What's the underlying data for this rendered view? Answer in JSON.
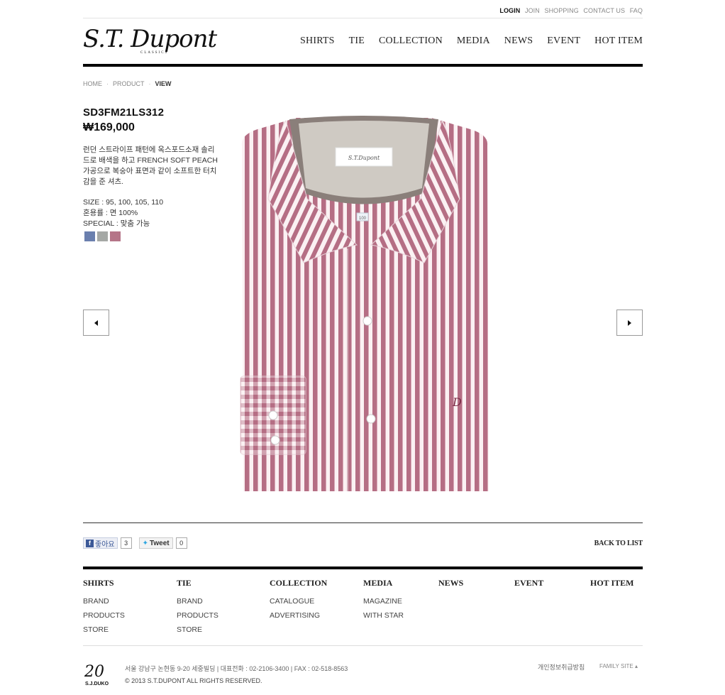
{
  "util": {
    "login": "LOGIN",
    "join": "JOIN",
    "shopping": "SHOPPING",
    "contact": "CONTACT US",
    "faq": "FAQ"
  },
  "logo": {
    "main": "S.T. Dupont",
    "sub": "CLASSICS"
  },
  "gnb": [
    "SHIRTS",
    "TIE",
    "COLLECTION",
    "MEDIA",
    "NEWS",
    "EVENT",
    "HOT ITEM"
  ],
  "breadcrumb": {
    "home": "HOME",
    "product": "PRODUCT",
    "current": "VIEW",
    "sep": "·"
  },
  "product": {
    "code": "SD3FM21LS312",
    "price": "₩169,000",
    "desc": "런던 스트라이프 패턴에 옥스포드소재 솔리드로 배색을 하고 FRENCH SOFT PEACH 가공으로 복숭아 표면과 같이 소프트한 터치감을 준 셔츠.",
    "size": "SIZE : 95, 100, 105, 110",
    "material": "혼용률 : 면 100%",
    "special": "SPECIAL : 맞춤 가능",
    "swatches": [
      "#6a7fae",
      "#a5a8a5",
      "#b57588"
    ],
    "collar_label": "S.T.Dupont",
    "size_tag": "100",
    "monogram": "D"
  },
  "social": {
    "fb_label": "좋아요",
    "fb_count": "3",
    "tweet_label": "Tweet",
    "tweet_count": "0"
  },
  "back_to_list": "BACK TO LIST",
  "footer_nav": {
    "shirts": {
      "title": "SHIRTS",
      "items": [
        "BRAND",
        "PRODUCTS",
        "STORE"
      ]
    },
    "tie": {
      "title": "TIE",
      "items": [
        "BRAND",
        "PRODUCTS",
        "STORE"
      ]
    },
    "collection": {
      "title": "COLLECTION",
      "items": [
        "CATALOGUE",
        "ADVERTISING"
      ]
    },
    "media": {
      "title": "MEDIA",
      "items": [
        "MAGAZINE",
        "WITH STAR"
      ]
    },
    "news": {
      "title": "NEWS"
    },
    "event": {
      "title": "EVENT"
    },
    "hot": {
      "title": "HOT ITEM"
    }
  },
  "footer": {
    "logo": "20",
    "logo_sub": "S.J.DUKO",
    "address": "서울 강남구 논현동 9-20 세중빌딩  |  대표전화 : 02-2106-3400  |  FAX : 02-518-8563",
    "copyright": "© 2013 S.T.DUPONT ALL RIGHTS RESERVED.",
    "privacy": "개인정보취급방침",
    "family_site": "FAMILY SITE ▴"
  }
}
